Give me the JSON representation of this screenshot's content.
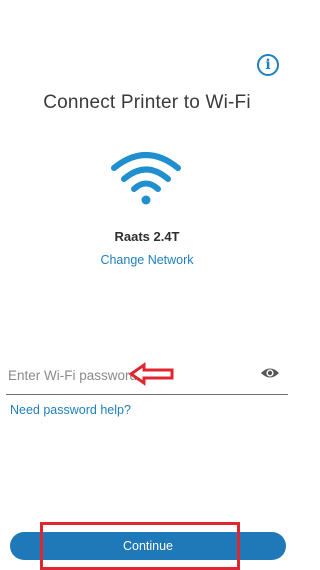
{
  "header": {
    "info_icon": "info-icon",
    "info_glyph": "i",
    "title": "Connect Printer to Wi-Fi"
  },
  "network": {
    "icon": "wifi-icon",
    "name": "Raats 2.4T",
    "change_label": "Change Network"
  },
  "password": {
    "placeholder": "Enter Wi-Fi password",
    "value": "",
    "visibility_icon": "eye-icon"
  },
  "help": {
    "label": "Need password help?"
  },
  "footer": {
    "continue_label": "Continue"
  },
  "annotations": {
    "arrow_icon": "left-arrow-icon",
    "highlight": "highlight-box"
  },
  "colors": {
    "accent": "#1f7fbf",
    "button": "#1f78b8",
    "title": "#3a3a3a",
    "annotation": "#e0262f"
  }
}
